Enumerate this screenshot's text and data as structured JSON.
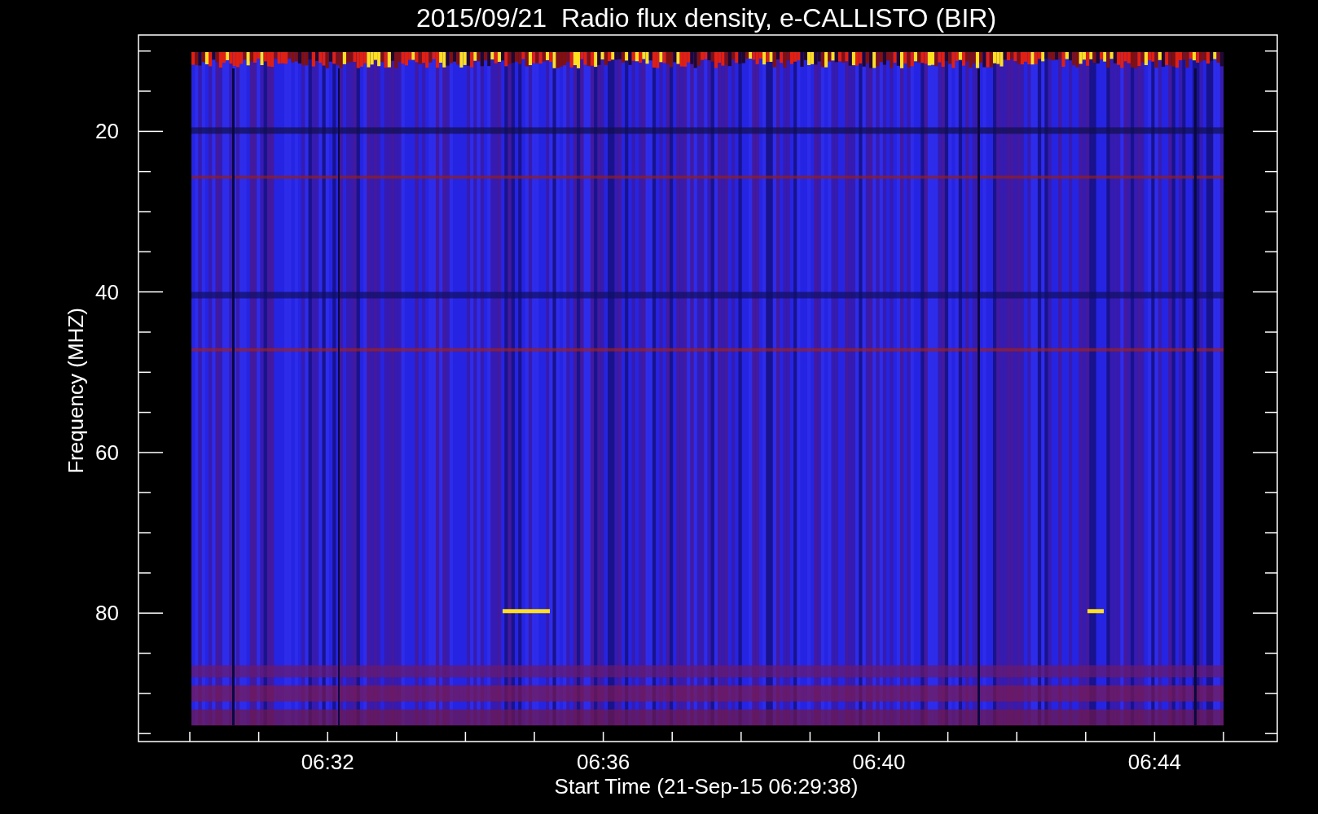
{
  "title": "2015/09/21  Radio flux density, e-CALLISTO (BIR)",
  "y_axis": {
    "label": "Frequency (MHZ)",
    "ticks": [
      "20",
      "40",
      "60",
      "80"
    ]
  },
  "x_axis": {
    "label": "Start Time (21-Sep-15 06:29:38)",
    "ticks": [
      "06:32",
      "06:36",
      "06:40",
      "06:44"
    ]
  }
}
